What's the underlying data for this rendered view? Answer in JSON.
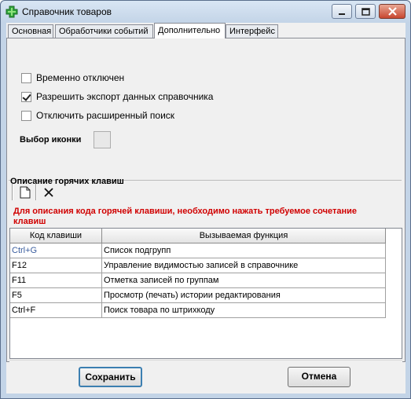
{
  "window": {
    "title": "Справочник товаров",
    "icon": "green-cross-icon"
  },
  "tabs": [
    {
      "label": "Основная",
      "active": false
    },
    {
      "label": "Обработчики событий",
      "active": false
    },
    {
      "label": "Дополнительно",
      "active": true
    },
    {
      "label": "Интерфейс",
      "active": false
    }
  ],
  "options": {
    "disabled": {
      "label": "Временно отключен",
      "checked": false
    },
    "export": {
      "label": "Разрешить экспорт данных справочника",
      "checked": true
    },
    "adv_search": {
      "label": "Отключить расширенный поиск",
      "checked": false
    }
  },
  "icon_select": {
    "label": "Выбор иконки"
  },
  "hotkeys": {
    "group_title": "Описание горячих клавиш",
    "toolbar": [
      {
        "icon": "new-document-icon"
      },
      {
        "icon": "delete-x-icon"
      }
    ],
    "note": "Для описания кода горячей клавиши, необходимо нажать требуемое сочетание клавиш",
    "columns": [
      "Код клавиши",
      "Вызываемая функция"
    ],
    "rows": [
      {
        "key": "Ctrl+G",
        "func": "Список подгрупп"
      },
      {
        "key": "F12",
        "func": "Управление видимостью записей в справочнике"
      },
      {
        "key": "F11",
        "func": "Отметка записей по группам"
      },
      {
        "key": "F5",
        "func": "Просмотр (печать) истории редактирования"
      },
      {
        "key": "Ctrl+F",
        "func": "Поиск товара по штрихкоду"
      }
    ]
  },
  "buttons": {
    "save": "Сохранить",
    "cancel": "Отмена"
  },
  "colors": {
    "note": "#d00000",
    "selection_text": "#3a5d9e"
  }
}
